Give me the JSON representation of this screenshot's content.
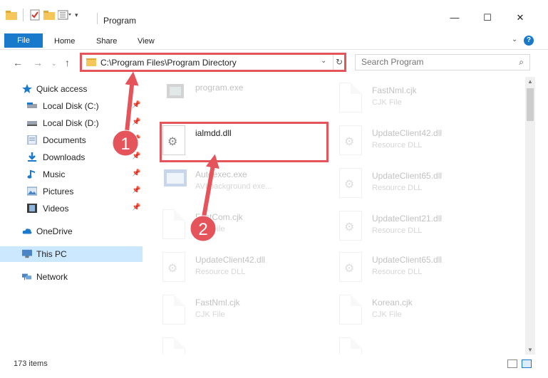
{
  "window": {
    "title": "Program",
    "minimize_glyph": "—",
    "maximize_glyph": "☐",
    "close_glyph": "✕"
  },
  "ribbon": {
    "file": "File",
    "home": "Home",
    "share": "Share",
    "view": "View",
    "help": "?"
  },
  "address": {
    "path": "C:\\Program Files\\Program Directory",
    "search_placeholder": "Search Program"
  },
  "sidebar": {
    "items": [
      {
        "label": "Quick access",
        "icon": "star-icon"
      },
      {
        "label": "Local Disk (C:)",
        "icon": "drive-icon"
      },
      {
        "label": "Local Disk (D:)",
        "icon": "drive-icon"
      },
      {
        "label": "Documents",
        "icon": "documents-icon"
      },
      {
        "label": "Downloads",
        "icon": "download-arrow-icon"
      },
      {
        "label": "Music",
        "icon": "music-note-icon"
      },
      {
        "label": "Pictures",
        "icon": "pictures-icon"
      },
      {
        "label": "Videos",
        "icon": "film-icon"
      },
      {
        "label": "OneDrive",
        "icon": "cloud-icon"
      },
      {
        "label": "This PC",
        "icon": "monitor-icon"
      },
      {
        "label": "Network",
        "icon": "network-icon"
      }
    ]
  },
  "files": {
    "program_exe": {
      "name": "program.exe",
      "desc": ""
    },
    "ialmdd": {
      "name": "ialmdd.dll",
      "desc": ""
    },
    "autoexec": {
      "name": "Autoexec.exe",
      "desc": "AVI background exe..."
    },
    "fastcom": {
      "name": "FastCom.cjk",
      "desc": "CJK File"
    },
    "update42_left": {
      "name": "UpdateClient42.dll",
      "desc": "Resource DLL"
    },
    "fastnml_left": {
      "name": "FastNml.cjk",
      "desc": "CJK File"
    },
    "fastnml_right": {
      "name": "FastNml.cjk",
      "desc": "CJK File"
    },
    "update42_right": {
      "name": "UpdateClient42.dll",
      "desc": "Resource DLL"
    },
    "update65_a": {
      "name": "UpdateClient65.dll",
      "desc": "Resource DLL"
    },
    "update21": {
      "name": "UpdateClient21.dll",
      "desc": "Resource DLL"
    },
    "update65_b": {
      "name": "UpdateClient65.dll",
      "desc": "Resource DLL"
    },
    "korean": {
      "name": "Korean.cjk",
      "desc": "CJK File"
    }
  },
  "status": {
    "count": "173 items"
  },
  "annotations": {
    "step1": "1",
    "step2": "2",
    "color": "#e5545b"
  }
}
